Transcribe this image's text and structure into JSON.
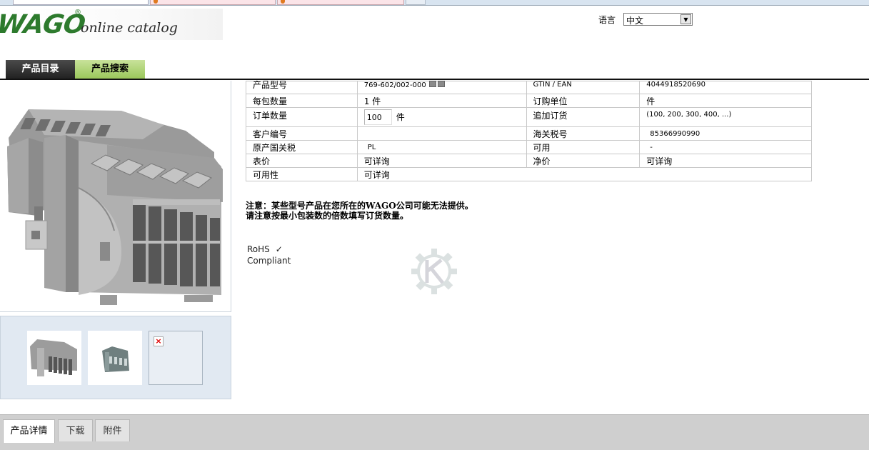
{
  "header": {
    "logo_text": "WAGO",
    "logo_registered": "®",
    "logo_subtitle": "online catalog",
    "language_label": "语言",
    "language_value": "中文"
  },
  "nav": {
    "tabs": [
      {
        "label": "产品目录"
      },
      {
        "label": "产品搜索"
      }
    ]
  },
  "details": {
    "rows": [
      {
        "k1": "产品型号",
        "v1": "769-602/002-000",
        "k2": "GTIN / EAN",
        "v2": "4044918520690"
      },
      {
        "k1": "每包数量",
        "v1": "1 件",
        "k2": "订购单位",
        "v2": "件"
      },
      {
        "k1": "订单数量",
        "v1": "100",
        "v1_unit": "件",
        "k2": "追加订货",
        "v2": "(100, 200, 300, 400, ...)"
      },
      {
        "k1": "客户编号",
        "v1": "",
        "k2": "海关税号",
        "v2": "85366990990"
      },
      {
        "k1": "原产国关税",
        "v1": "PL",
        "k2": "可用",
        "v2": "-"
      },
      {
        "k1": "表价",
        "v1": "可详询",
        "k2": "净价",
        "v2": "可详询"
      },
      {
        "k1": "可用性",
        "v1": "可详询"
      }
    ]
  },
  "notice": {
    "line1": "注意：某些型号产品在您所在的WAGO公司可能无法提供。",
    "line2": "请注意按最小包装数的倍数填写订货数量。"
  },
  "rohs": {
    "label": "RoHS",
    "check": "✓",
    "status": "Compliant"
  },
  "bottom_tabs": [
    {
      "label": "产品详情"
    },
    {
      "label": "下载"
    },
    {
      "label": "附件"
    }
  ],
  "colors": {
    "brand_green": "#2d7a2d",
    "nav_active": "#9bc75b",
    "nav_dark": "#222222",
    "thumb_panel": "#e1e9f2"
  }
}
